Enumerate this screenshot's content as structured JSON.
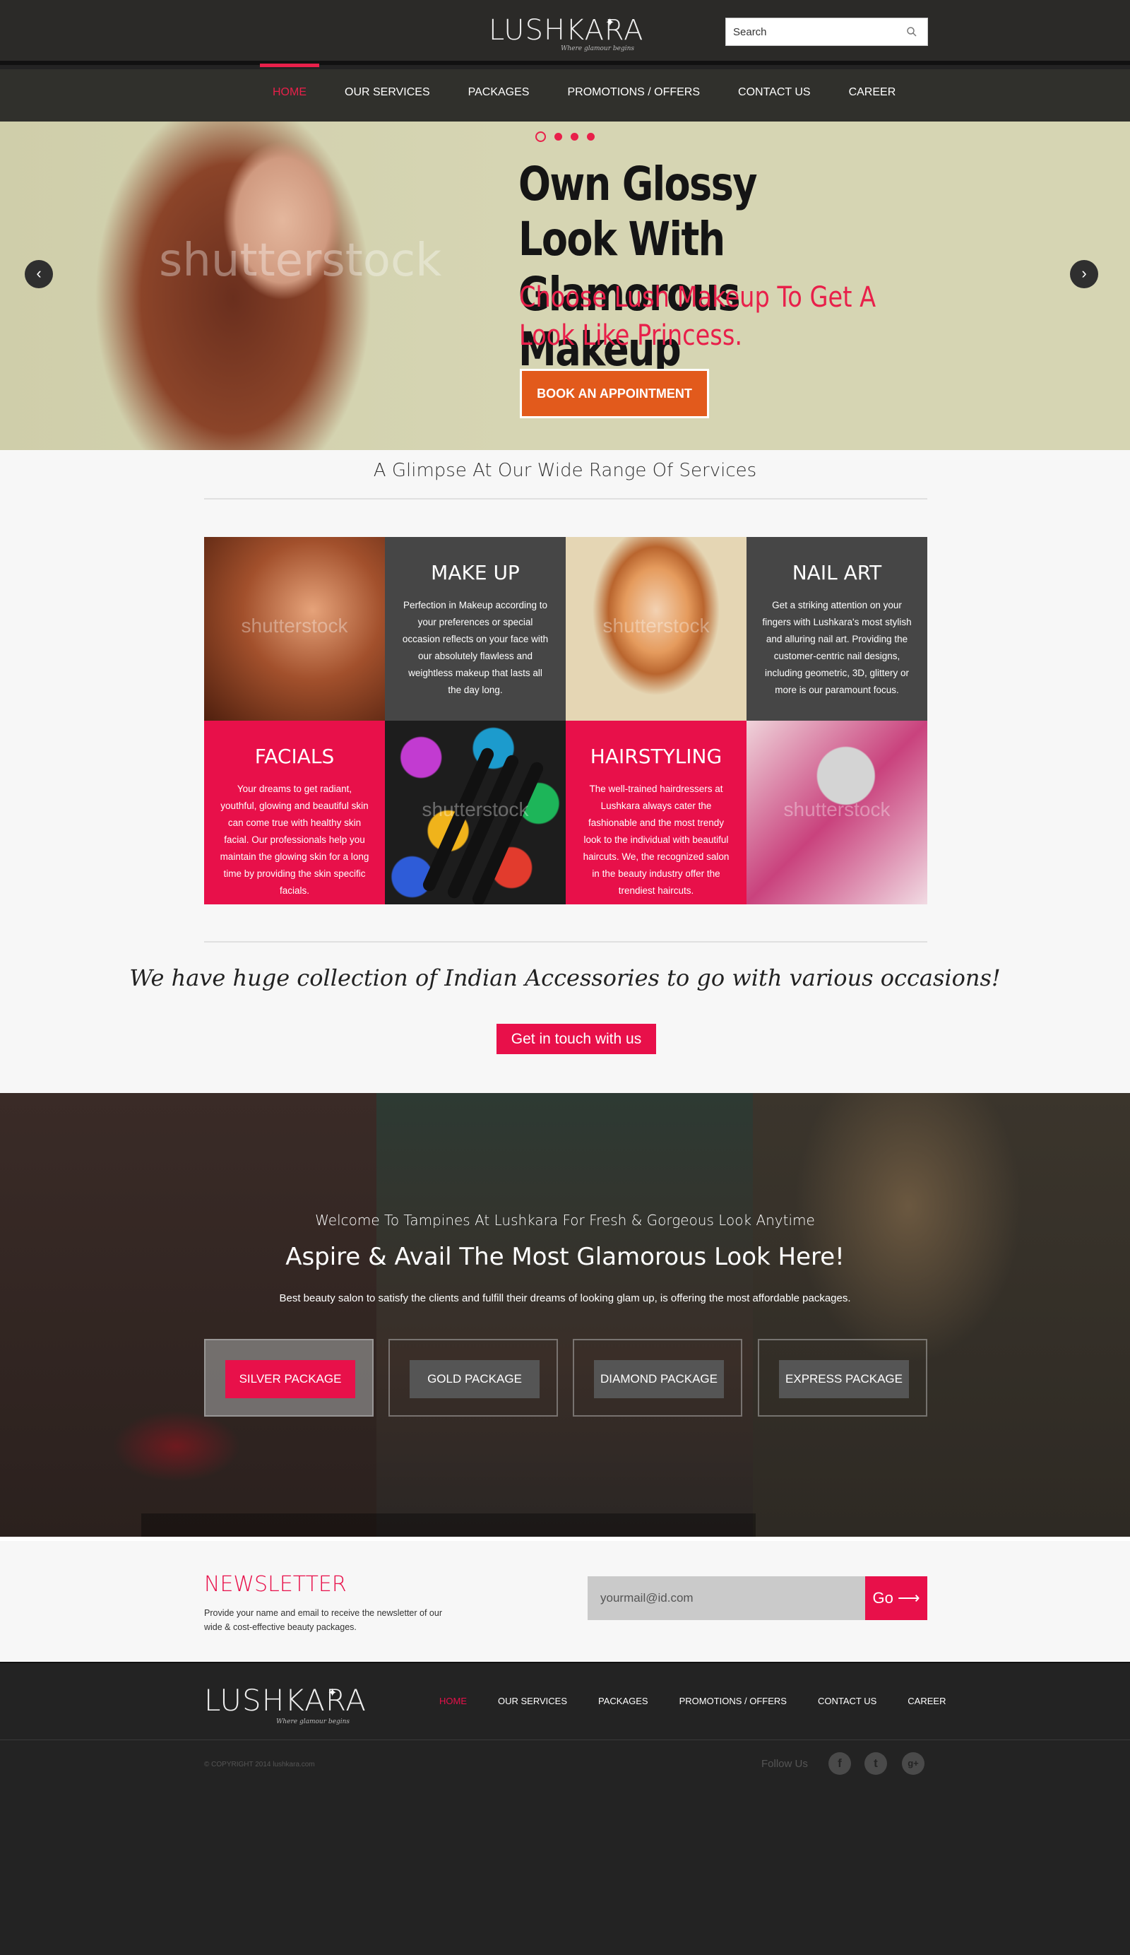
{
  "header": {
    "logo_text": "LUSHKARA",
    "logo_tagline": "Where glamour begins",
    "search_placeholder": "Search"
  },
  "nav": {
    "items": [
      {
        "label": "HOME",
        "active": true
      },
      {
        "label": "OUR SERVICES"
      },
      {
        "label": "PACKAGES"
      },
      {
        "label": "PROMOTIONS / OFFERS"
      },
      {
        "label": "CONTACT US"
      },
      {
        "label": "CAREER"
      }
    ]
  },
  "hero": {
    "watermark": "shutterstock",
    "title": "Own Glossy Look With Glamorous Makeup",
    "subtitle": "Choose Lush Makeup To Get A Look Like Princess.",
    "cta": "BOOK AN APPOINTMENT",
    "slides": 4,
    "active_slide": 1
  },
  "services": {
    "heading": "A Glimpse At Our Wide Range Of Services",
    "watermark": "shutterstock",
    "tiles": [
      {
        "title": "MAKE UP",
        "text": "Perfection in Makeup according to your preferences or special occasion reflects on your face with our absolutely flawless and weightless makeup that lasts all the day long."
      },
      {
        "title": "NAIL ART",
        "text": "Get a striking attention on your fingers with Lushkara's most stylish and alluring nail art. Providing the customer-centric nail designs, including geometric, 3D, glittery or more is our paramount focus."
      },
      {
        "title": "FACIALS",
        "text": "Your dreams to get radiant, youthful, glowing and beautiful skin can come true with healthy skin facial. Our professionals help you maintain the glowing skin for a long time by providing the skin specific facials."
      },
      {
        "title": "HAIRSTYLING",
        "text": "The well-trained hairdressers at Lushkara always cater the fashionable and the most trendy look to the individual with beautiful haircuts. We, the recognized salon in the beauty industry offer the trendiest haircuts."
      }
    ],
    "accessories": "We have huge collection of Indian Accessories to go with various occasions!",
    "contact_btn": "Get in touch with us"
  },
  "packages": {
    "welcome": "Welcome To Tampines At Lushkara For Fresh & Gorgeous Look Anytime",
    "title": "Aspire & Avail The Most Glamorous Look Here!",
    "desc": "Best beauty salon to satisfy the clients and fulfill their dreams of looking glam up, is offering the most affordable packages.",
    "items": [
      "SILVER PACKAGE",
      "GOLD PACKAGE",
      "DIAMOND PACKAGE",
      "EXPRESS PACKAGE"
    ],
    "active": 0
  },
  "newsletter": {
    "title": "NEWSLETTER",
    "text": "Provide your name and email to receive the newsletter of our wide & cost-effective beauty packages.",
    "placeholder": "yourmail@id.com",
    "button": "Go ⟶"
  },
  "footer": {
    "logo_text": "LUSHKARA",
    "logo_tagline": "Where glamour begins",
    "nav": [
      "HOME",
      "OUR SERVICES",
      "PACKAGES",
      "PROMOTIONS / OFFERS",
      "CONTACT US",
      "CAREER"
    ],
    "copyright": "© COPYRIGHT 2014 lushkara.com",
    "follow": "Follow Us",
    "social": [
      {
        "icon": "facebook-icon",
        "glyph": "f"
      },
      {
        "icon": "twitter-icon",
        "glyph": "t"
      },
      {
        "icon": "google-plus-icon",
        "glyph": "g+"
      }
    ]
  },
  "colors": {
    "accent": "#e8104a",
    "cta_orange": "#e25a1c",
    "hero_bg": "#d6d5b3",
    "tile_dark": "#464646"
  }
}
